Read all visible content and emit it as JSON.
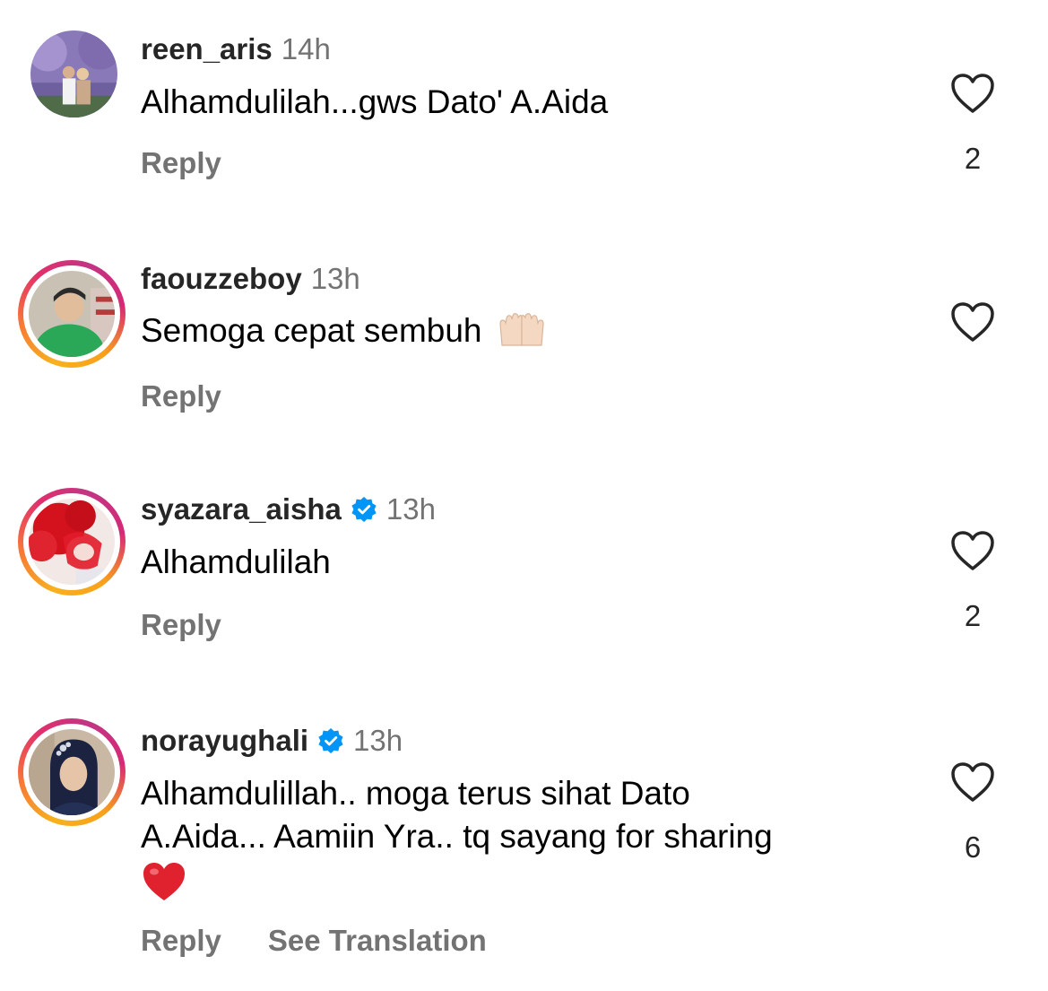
{
  "comments": [
    {
      "username": "reen_aris",
      "time": "14h",
      "verified": false,
      "text_lines": [
        "Alhamdulilah...gws Dato' A.Aida"
      ],
      "reply_label": "Reply",
      "likes": "2"
    },
    {
      "username": "faouzzeboy",
      "time": "13h",
      "verified": false,
      "text_lines": [
        "Semoga cepat sembuh"
      ],
      "emoji": "raised-hands",
      "reply_label": "Reply",
      "likes": ""
    },
    {
      "username": "syazara_aisha",
      "time": "13h",
      "verified": true,
      "text_lines": [
        "Alhamdulilah"
      ],
      "reply_label": "Reply",
      "likes": "2"
    },
    {
      "username": "norayughali",
      "time": "13h",
      "verified": true,
      "text_lines": [
        "Alhamdulillah.. moga terus sihat Dato",
        "A.Aida... Aamiin Yra.. tq sayang for sharing"
      ],
      "emoji": "red-heart",
      "reply_label": "Reply",
      "see_translation_label": "See Translation",
      "likes": "6"
    }
  ],
  "icons": {
    "like": "heart-outline-icon",
    "verified": "verified-badge-icon"
  },
  "colors": {
    "verified_blue": "#0095f6",
    "secondary_text": "#737373"
  }
}
